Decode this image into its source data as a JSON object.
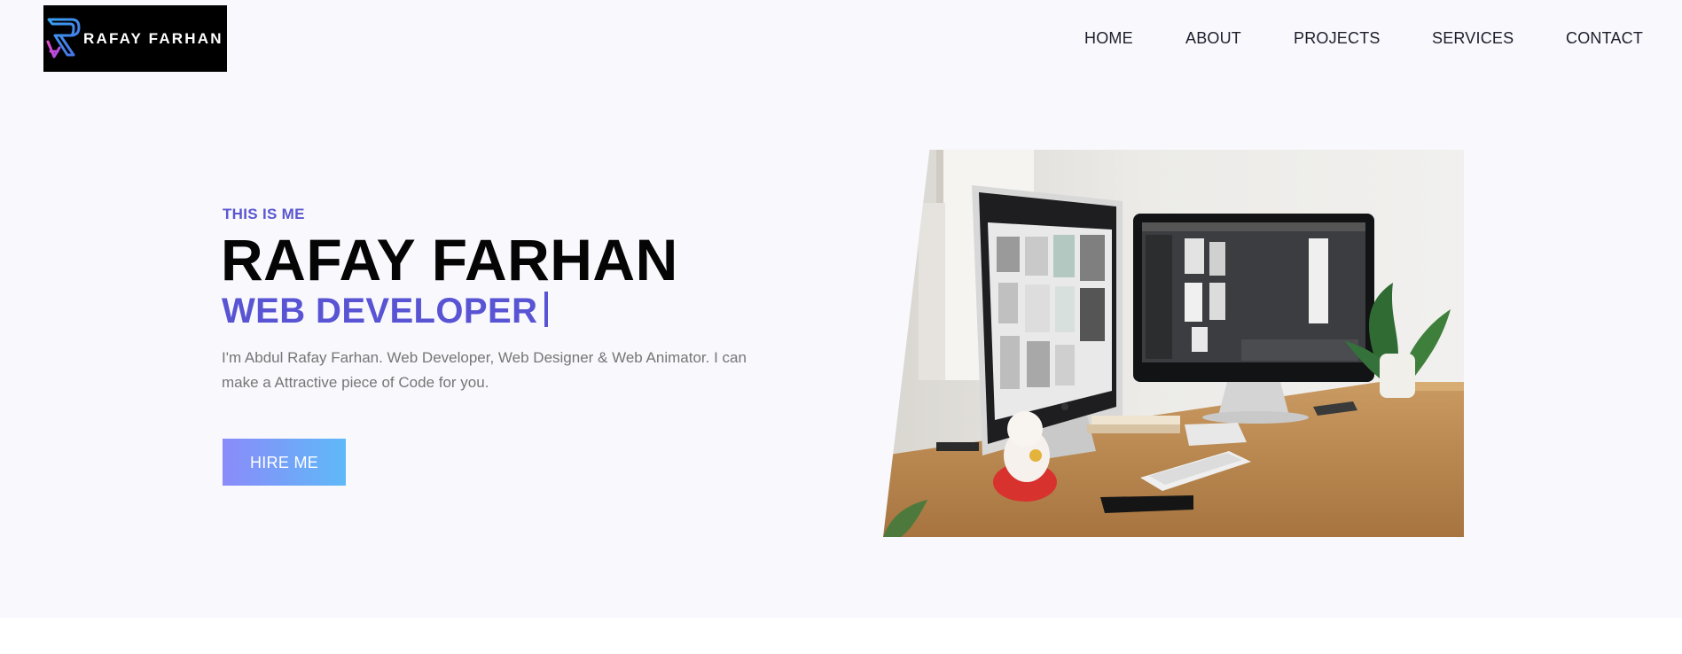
{
  "brand": {
    "name": "RAFAY FARHAN",
    "logo_icon": "rf-logo-mark"
  },
  "nav": {
    "items": [
      {
        "label": "HOME"
      },
      {
        "label": "ABOUT"
      },
      {
        "label": "PROJECTS"
      },
      {
        "label": "SERVICES"
      },
      {
        "label": "CONTACT"
      }
    ]
  },
  "hero": {
    "eyebrow": "THIS IS ME",
    "name": "RAFAY FARHAN",
    "role": "WEB DEVELOPER",
    "description": "I'm Abdul Rafay Farhan. Web Developer, Web Designer & Web Animator. I can make a Attractive piece of Code for you.",
    "cta_label": "HIRE ME",
    "image_icon": "workspace-dual-monitor-photo"
  },
  "colors": {
    "accent": "#5954d3",
    "page_bg": "#f8f8fd",
    "button_start": "#8a8bf9",
    "button_end": "#5fb9f8",
    "logo_bg": "#000000"
  }
}
